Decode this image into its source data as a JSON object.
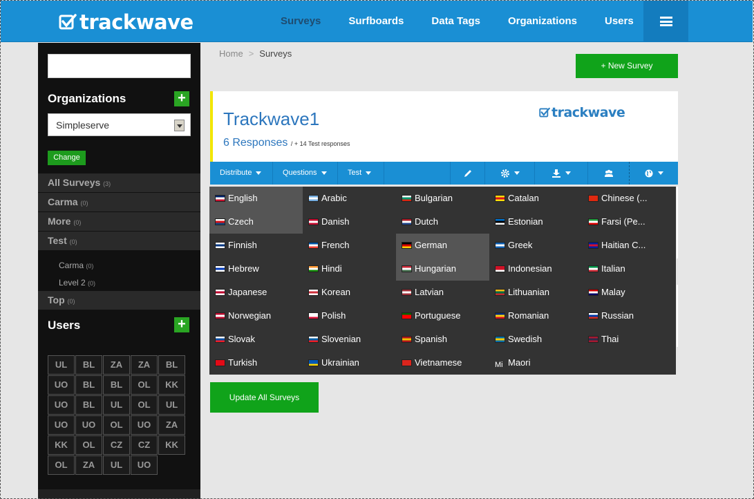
{
  "app": {
    "logo_text": "trackwave"
  },
  "nav": {
    "items": [
      {
        "label": "Surveys",
        "active": true
      },
      {
        "label": "Surfboards"
      },
      {
        "label": "Data Tags"
      },
      {
        "label": "Organizations"
      },
      {
        "label": "Users"
      }
    ]
  },
  "sidebar": {
    "search_value": "",
    "organizations_heading": "Organizations",
    "org_add_label": "+",
    "selected_org": "Simpleserve",
    "change_label": "Change",
    "groups": [
      {
        "label": "All Surveys",
        "count": "(3)"
      },
      {
        "label": "Carma",
        "count": "(0)"
      },
      {
        "label": "More",
        "count": "(0)"
      },
      {
        "label": "Test",
        "count": "(0)"
      }
    ],
    "subgroups": [
      {
        "label": "Carma",
        "count": "(0)"
      },
      {
        "label": "Level 2",
        "count": "(0)"
      }
    ],
    "last_group": {
      "label": "Top",
      "count": "(0)"
    },
    "users_heading": "Users",
    "users_add_label": "+",
    "user_initials": [
      "UL",
      "BL",
      "ZA",
      "ZA",
      "BL",
      "UO",
      "BL",
      "BL",
      "OL",
      "KK",
      "UO",
      "BL",
      "UL",
      "OL",
      "UL",
      "UO",
      "UO",
      "OL",
      "UO",
      "ZA",
      "KK",
      "OL",
      "CZ",
      "CZ",
      "KK",
      "OL",
      "ZA",
      "UL",
      "UO"
    ]
  },
  "breadcrumb": {
    "home": "Home",
    "separator": ">",
    "current": "Surveys"
  },
  "new_survey_button": "+ New Survey",
  "survey": {
    "title": "Trackwave1",
    "responses": "6 Responses",
    "test_responses": "/ + 14 Test responses",
    "logo_text": "trackwave"
  },
  "toolbar": {
    "distribute": "Distribute",
    "questions": "Questions",
    "test": "Test"
  },
  "languages": [
    {
      "name": "English",
      "highlight": true,
      "flag": [
        "#012169",
        "#ffffff",
        "#c8102e"
      ]
    },
    {
      "name": "Arabic",
      "flag": [
        "#74acdf",
        "#ffffff",
        "#74acdf"
      ]
    },
    {
      "name": "Bulgarian",
      "flag": [
        "#ffffff",
        "#00966e",
        "#d62612"
      ]
    },
    {
      "name": "Catalan",
      "flag": [
        "#fcdd09",
        "#da121a",
        "#fcdd09"
      ]
    },
    {
      "name": "Chinese (...",
      "flag": [
        "#de2910",
        "#de2910",
        "#de2910"
      ]
    },
    {
      "name": "Czech",
      "highlight": true,
      "flag": [
        "#ffffff",
        "#d7141a",
        "#11457e"
      ]
    },
    {
      "name": "Danish",
      "flag": [
        "#c60c30",
        "#ffffff",
        "#c60c30"
      ]
    },
    {
      "name": "Dutch",
      "flag": [
        "#ae1c28",
        "#ffffff",
        "#21468b"
      ]
    },
    {
      "name": "Estonian",
      "flag": [
        "#0072ce",
        "#000000",
        "#ffffff"
      ]
    },
    {
      "name": "Farsi (Pe...",
      "flag": [
        "#239f40",
        "#ffffff",
        "#da0000"
      ]
    },
    {
      "name": "Finnish",
      "flag": [
        "#ffffff",
        "#003580",
        "#ffffff"
      ]
    },
    {
      "name": "French",
      "flag": [
        "#0055a4",
        "#ffffff",
        "#ef4135"
      ]
    },
    {
      "name": "German",
      "highlight": true,
      "flag": [
        "#000000",
        "#dd0000",
        "#ffce00"
      ]
    },
    {
      "name": "Greek",
      "flag": [
        "#0d5eaf",
        "#ffffff",
        "#0d5eaf"
      ]
    },
    {
      "name": "Haitian C...",
      "flag": [
        "#00209f",
        "#d21034",
        "#00209f"
      ]
    },
    {
      "name": "Hebrew",
      "flag": [
        "#ffffff",
        "#0038b8",
        "#ffffff"
      ]
    },
    {
      "name": "Hindi",
      "flag": [
        "#ff9933",
        "#ffffff",
        "#138808"
      ]
    },
    {
      "name": "Hungarian",
      "highlight": true,
      "flag": [
        "#ce2939",
        "#ffffff",
        "#477050"
      ]
    },
    {
      "name": "Indonesian",
      "flag": [
        "#ce1126",
        "#ce1126",
        "#ffffff"
      ]
    },
    {
      "name": "Italian",
      "flag": [
        "#009246",
        "#ffffff",
        "#ce2b37"
      ]
    },
    {
      "name": "Japanese",
      "flag": [
        "#ffffff",
        "#bc002d",
        "#ffffff"
      ]
    },
    {
      "name": "Korean",
      "flag": [
        "#ffffff",
        "#cd2e3a",
        "#ffffff"
      ]
    },
    {
      "name": "Latvian",
      "flag": [
        "#9e3039",
        "#ffffff",
        "#9e3039"
      ]
    },
    {
      "name": "Lithuanian",
      "flag": [
        "#fdb913",
        "#006a44",
        "#c1272d"
      ]
    },
    {
      "name": "Malay",
      "flag": [
        "#cc0001",
        "#ffffff",
        "#010066"
      ]
    },
    {
      "name": "Norwegian",
      "flag": [
        "#ba0c2f",
        "#ffffff",
        "#ba0c2f"
      ]
    },
    {
      "name": "Polish",
      "flag": [
        "#ffffff",
        "#ffffff",
        "#dc143c"
      ]
    },
    {
      "name": "Portuguese",
      "flag": [
        "#006600",
        "#ff0000",
        "#ff0000"
      ]
    },
    {
      "name": "Romanian",
      "flag": [
        "#002b7f",
        "#fcd116",
        "#ce1126"
      ]
    },
    {
      "name": "Russian",
      "flag": [
        "#ffffff",
        "#0039a6",
        "#d52b1e"
      ]
    },
    {
      "name": "Slovak",
      "flag": [
        "#ffffff",
        "#0b4ea2",
        "#ee1c25"
      ]
    },
    {
      "name": "Slovenian",
      "flag": [
        "#ffffff",
        "#005da4",
        "#ed1c24"
      ]
    },
    {
      "name": "Spanish",
      "flag": [
        "#aa151b",
        "#f1bf00",
        "#aa151b"
      ]
    },
    {
      "name": "Swedish",
      "flag": [
        "#006aa7",
        "#fecc00",
        "#006aa7"
      ]
    },
    {
      "name": "Thai",
      "flag": [
        "#a51931",
        "#2d2a4a",
        "#a51931"
      ]
    },
    {
      "name": "Turkish",
      "flag": [
        "#e30a17",
        "#e30a17",
        "#e30a17"
      ]
    },
    {
      "name": "Ukrainian",
      "flag": [
        "#0057b7",
        "#0057b7",
        "#ffd700"
      ]
    },
    {
      "name": "Vietnamese",
      "flag": [
        "#da251d",
        "#da251d",
        "#da251d"
      ]
    },
    {
      "name": "Maori",
      "flag_text": "Mi"
    }
  ],
  "update_button": "Update All Surveys"
}
